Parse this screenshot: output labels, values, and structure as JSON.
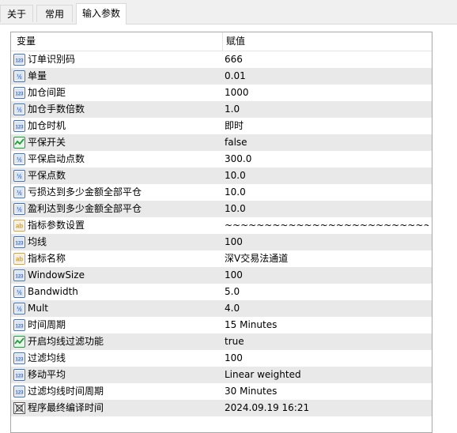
{
  "tabs": [
    {
      "label": "关于",
      "active": false
    },
    {
      "label": "常用",
      "active": false
    },
    {
      "label": "输入参数",
      "active": true
    }
  ],
  "table": {
    "headers": {
      "name": "变量",
      "value": "赋值"
    },
    "rows": [
      {
        "icon": "int",
        "name": "订单识别码",
        "value": "666"
      },
      {
        "icon": "double",
        "name": "单量",
        "value": "0.01"
      },
      {
        "icon": "int",
        "name": "加仓间距",
        "value": "1000"
      },
      {
        "icon": "double",
        "name": "加仓手数倍数",
        "value": "1.0"
      },
      {
        "icon": "int",
        "name": "加仓时机",
        "value": "即时"
      },
      {
        "icon": "bool",
        "name": "平保开关",
        "value": "false"
      },
      {
        "icon": "double",
        "name": "平保启动点数",
        "value": "300.0"
      },
      {
        "icon": "double",
        "name": "平保点数",
        "value": "10.0"
      },
      {
        "icon": "double",
        "name": "亏损达到多少金额全部平仓",
        "value": "10.0"
      },
      {
        "icon": "double",
        "name": "盈利达到多少金额全部平仓",
        "value": "10.0"
      },
      {
        "icon": "string",
        "name": "指标参数设置",
        "value": "~~~~~~~~~~~~~~~~~~~~~~~~~~~~~~..."
      },
      {
        "icon": "int",
        "name": "均线",
        "value": "100"
      },
      {
        "icon": "string",
        "name": "指标名称",
        "value": "深V交易法通道"
      },
      {
        "icon": "int",
        "name": "WindowSize",
        "value": "100"
      },
      {
        "icon": "double",
        "name": "Bandwidth",
        "value": "5.0"
      },
      {
        "icon": "double",
        "name": "Mult",
        "value": "4.0"
      },
      {
        "icon": "int",
        "name": "时间周期",
        "value": "15 Minutes"
      },
      {
        "icon": "bool",
        "name": "开启均线过滤功能",
        "value": "true"
      },
      {
        "icon": "int",
        "name": "过滤均线",
        "value": "100"
      },
      {
        "icon": "int",
        "name": "移动平均",
        "value": "Linear weighted"
      },
      {
        "icon": "int",
        "name": "过滤均线时间周期",
        "value": "30 Minutes"
      },
      {
        "icon": "datetime",
        "name": "程序最终编译时间",
        "value": "2024.09.19 16:21"
      }
    ]
  },
  "icon_labels": {
    "int": "123",
    "double": "½",
    "string": "ab"
  },
  "colors": {
    "row_alt": "#e9e9e9",
    "grid_border": "#a8a8a8",
    "icon_blue": "#3a6fc4",
    "icon_green": "#1e9e3a"
  }
}
